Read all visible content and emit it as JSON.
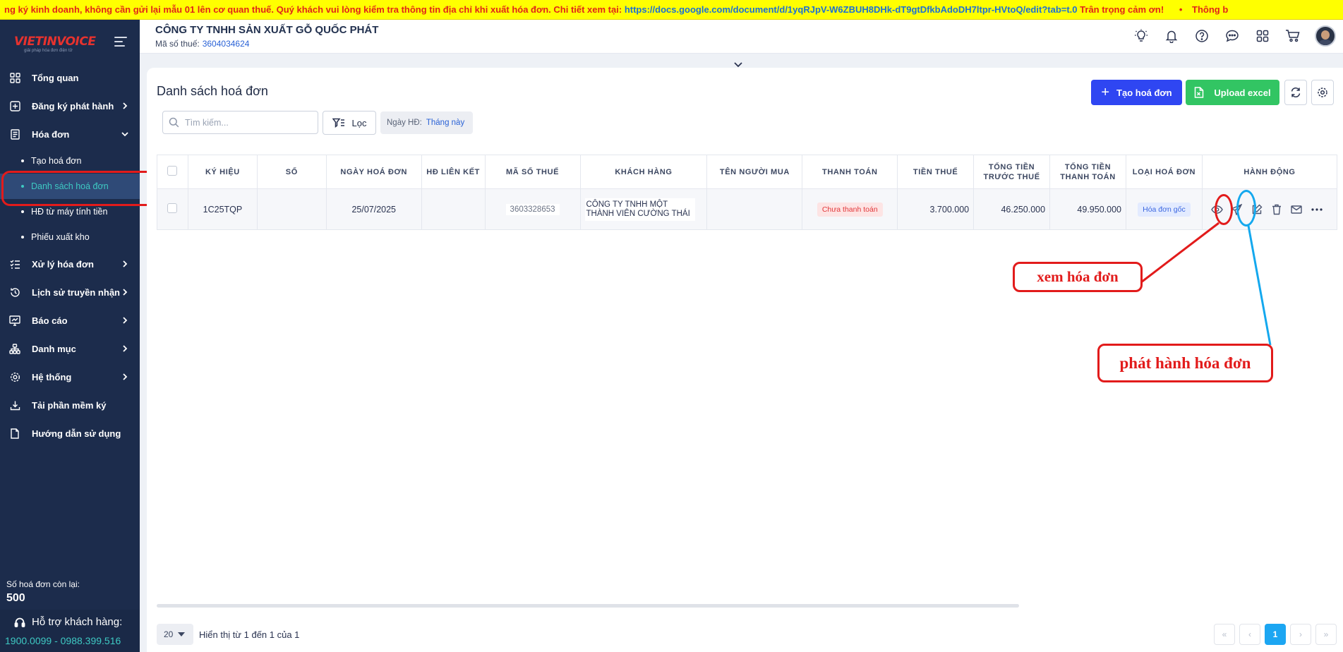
{
  "banner": {
    "text": "ng ký kinh doanh, không cần gửi lại mẫu 01 lên cơ quan thuế. Quý khách vui lòng kiểm tra thông tin địa chỉ khi xuất hóa đơn. Chi tiết xem tại:",
    "link": "https://docs.google.com/document/d/1yqRJpV-W6ZBUH8DHk-dT9gtDfkbAdoDH7ltpr-HVtoQ/edit?tab=t.0",
    "suffix": "Trân trọng cảm ơn!",
    "next": "Thông b"
  },
  "brand": {
    "logo": "VIETINVOICE",
    "tagline": "giải pháp hóa đơn điện tử"
  },
  "header": {
    "company": "CÔNG TY TNHH SẢN XUẤT GỖ QUỐC PHÁT",
    "tax_label": "Mã số thuế:",
    "tax_value": "3604034624"
  },
  "sidebar": {
    "items": [
      {
        "label": "Tổng quan",
        "icon": "dashboard-icon"
      },
      {
        "label": "Đăng ký phát hành",
        "icon": "plus-square-icon"
      },
      {
        "label": "Hóa đơn",
        "icon": "invoice-icon"
      },
      {
        "label": "Xử lý hóa đơn",
        "icon": "list-check-icon"
      },
      {
        "label": "Lịch sử truyền nhận",
        "icon": "history-icon"
      },
      {
        "label": "Báo cáo",
        "icon": "report-icon"
      },
      {
        "label": "Danh mục",
        "icon": "hierarchy-icon"
      },
      {
        "label": "Hệ thống",
        "icon": "gear-icon"
      },
      {
        "label": "Tải phần mềm ký",
        "icon": "download-icon"
      },
      {
        "label": "Hướng dẫn sử dụng",
        "icon": "document-icon"
      }
    ],
    "sub_items": [
      "Tạo hoá đơn",
      "Danh sách hoá đơn",
      "HĐ từ máy tính tiền",
      "Phiếu xuất kho"
    ],
    "remaining_label": "Số hoá đơn còn lại:",
    "remaining_value": "500",
    "support_title": "Hỗ trợ khách hàng:",
    "support_phone": "1900.0099 - 0988.399.516"
  },
  "page": {
    "title": "Danh sách hoá đơn",
    "create_label": "Tạo hoá đơn",
    "upload_label": "Upload excel",
    "search_placeholder": "Tìm kiếm...",
    "filter_label": "Lọc",
    "date_label": "Ngày HĐ:",
    "date_value": "Tháng này"
  },
  "table": {
    "columns": [
      "Ký hiệu",
      "Số",
      "Ngày hoá đơn",
      "HĐ liên kết",
      "Mã số thuế",
      "Khách hàng",
      "Tên người mua",
      "Thanh toán",
      "Tiền thuế",
      "Tổng tiền trước thuế",
      "Tổng tiền thanh toán",
      "Loại hoá đơn",
      "Hành động"
    ],
    "row": {
      "symbol": "1C25TQP",
      "number": "",
      "date": "25/07/2025",
      "linked": "",
      "tax_code": "3603328653",
      "customer": "CÔNG TY TNHH MỘT THÀNH VIÊN CƯỜNG THÁI",
      "buyer": "",
      "payment": "Chưa thanh toán",
      "tax": "3.700.000",
      "subtotal": "46.250.000",
      "total": "49.950.000",
      "type": "Hóa đơn gốc"
    }
  },
  "annotations": {
    "view": "xem hóa đơn",
    "issue": "phát hành hóa đơn"
  },
  "footer": {
    "page_size": "20",
    "showing": "Hiển thị từ 1 đến 1 của 1",
    "current_page": "1"
  },
  "colors": {
    "sidebar": "#1c2c4c",
    "accent_teal": "#3ec9c3",
    "primary": "#2f46f2",
    "success": "#32c563",
    "annotation_red": "#e21b1b",
    "annotation_blue": "#14a8ee"
  }
}
